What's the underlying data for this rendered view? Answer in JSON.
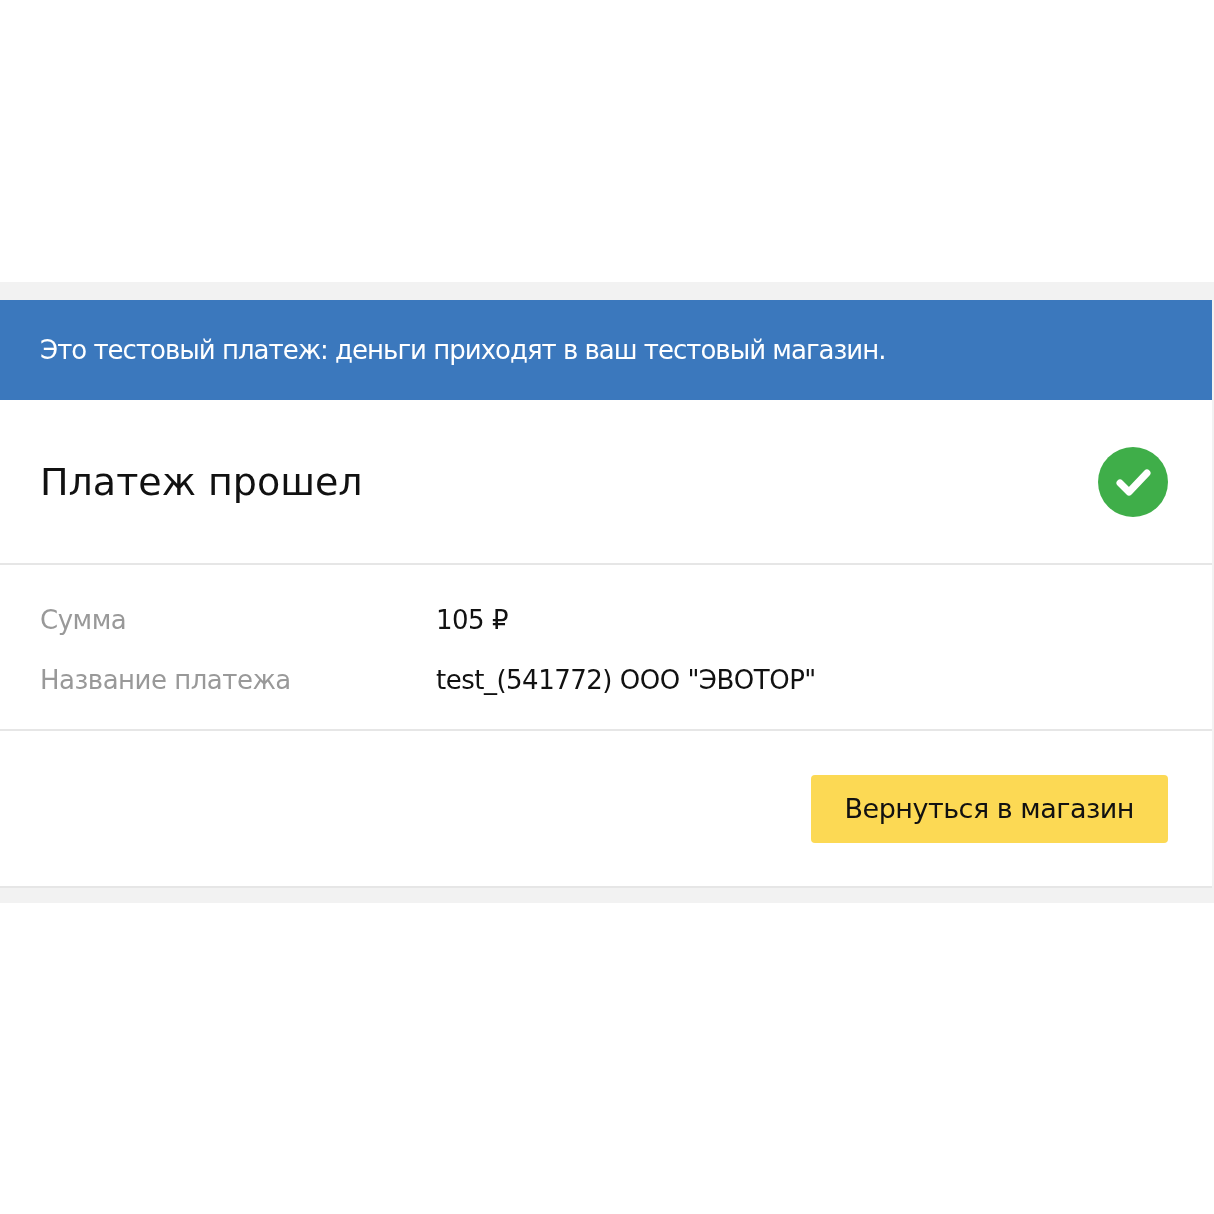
{
  "notice": {
    "text": "Это тестовый платеж: деньги приходят в ваш тестовый магазин."
  },
  "status": {
    "title": "Платеж прошел",
    "success": true
  },
  "details": [
    {
      "label": "Сумма",
      "value": "105 ₽"
    },
    {
      "label": "Название платежа",
      "value": "test_(541772) ООО \"ЭВОТОР\""
    }
  ],
  "button": {
    "label": "Вернуться в магазин"
  }
}
